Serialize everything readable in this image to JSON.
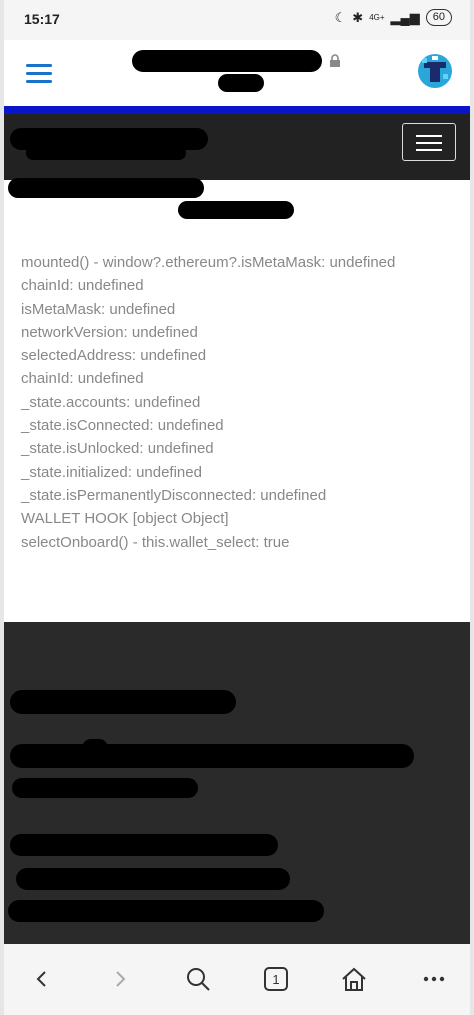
{
  "status_bar": {
    "time": "15:17",
    "network": "4G+",
    "battery": "60"
  },
  "debug_lines": [
    "mounted() - window?.ethereum?.isMetaMask: undefined",
    "chainId: undefined",
    "isMetaMask: undefined",
    "networkVersion: undefined",
    "selectedAddress: undefined",
    "chainId: undefined",
    "_state.accounts: undefined",
    "_state.isConnected: undefined",
    "_state.isUnlocked: undefined",
    "_state.initialized: undefined",
    "_state.isPermanentlyDisconnected: undefined",
    "WALLET HOOK [object Object]",
    "selectOnboard() - this.wallet_select: true"
  ],
  "toolbar": {
    "tab_count": "1"
  },
  "colors": {
    "accent_blue": "#0a14c8",
    "nav_dark": "#222222",
    "footer_dark": "#2a2a2a",
    "debug_text": "#888888"
  }
}
